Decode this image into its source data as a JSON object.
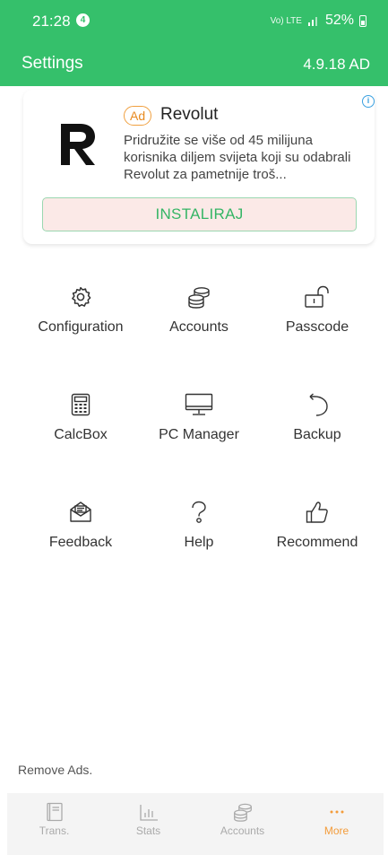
{
  "status_bar": {
    "time": "21:28",
    "notification_count": "4",
    "network": "Vo) LTE",
    "battery": "52%"
  },
  "app_bar": {
    "title": "Settings",
    "version": "4.9.18 AD"
  },
  "ad": {
    "badge": "Ad",
    "advertiser": "Revolut",
    "description": "Pridružite se više od 45 milijuna korisnika diljem svijeta koji su odabrali Revolut za pametnije troš...",
    "cta": "INSTALIRAJ",
    "info_icon": "i"
  },
  "settings_grid": [
    {
      "label": "Configuration",
      "icon": "gear-icon"
    },
    {
      "label": "Accounts",
      "icon": "coins-icon"
    },
    {
      "label": "Passcode",
      "icon": "unlock-icon"
    },
    {
      "label": "CalcBox",
      "icon": "calculator-icon"
    },
    {
      "label": "PC Manager",
      "icon": "monitor-icon"
    },
    {
      "label": "Backup",
      "icon": "restore-icon"
    },
    {
      "label": "Feedback",
      "icon": "mail-icon"
    },
    {
      "label": "Help",
      "icon": "question-icon"
    },
    {
      "label": "Recommend",
      "icon": "thumbs-up-icon"
    }
  ],
  "remove_ads": "Remove Ads.",
  "bottom_nav": {
    "tabs": [
      {
        "label": "Trans.",
        "icon": "book-icon"
      },
      {
        "label": "Stats",
        "icon": "bar-chart-icon"
      },
      {
        "label": "Accounts",
        "icon": "coins-icon"
      },
      {
        "label": "More",
        "icon": "more-icon"
      }
    ],
    "active": "More"
  },
  "colors": {
    "primary_green": "#35c06b",
    "accent_orange": "#f39c3a",
    "install_bg": "#fbe9e7"
  }
}
